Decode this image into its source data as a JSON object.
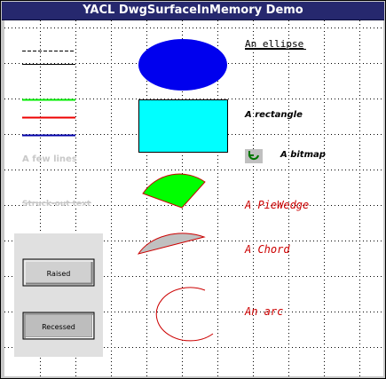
{
  "window": {
    "title": "YACL DwgSurfaceInMemory Demo"
  },
  "labels": {
    "ellipse": "An ellipse",
    "rectangle": "A rectangle",
    "bitmap": "A bitmap",
    "piewedge": "A PieWedge",
    "chord": "A Chord",
    "arc": "An arc",
    "lines": "A few lines",
    "strikeout": "Struck-out text"
  },
  "buttons": {
    "raised": "Raised",
    "recessed": "Recessed"
  },
  "colors": {
    "title_bg": "#26286e",
    "ellipse_fill": "#0000ee",
    "rectangle_fill": "#00ffff",
    "wedge_fill": "#00ff00",
    "chord_fill": "#c0c0c0",
    "shape_outline": "#cc0000",
    "red_text": "#cc0000",
    "grid": "#000000",
    "line_green": "#00ee00",
    "line_red": "#ee0000",
    "line_blue": "#0000aa",
    "faded_text": "#c8c8c8"
  }
}
